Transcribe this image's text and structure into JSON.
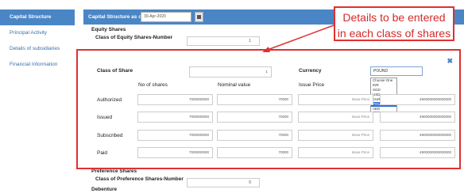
{
  "sidebar": {
    "items": [
      {
        "label": "Capital Structure"
      },
      {
        "label": "Principal Activity"
      },
      {
        "label": "Details of subsidiaries"
      },
      {
        "label": "Financial Information"
      }
    ]
  },
  "header": {
    "label": "Capital Structure as on",
    "date": "30-Apr-2020"
  },
  "form": {
    "equity_section": "Equity Shares",
    "equity_count_label": "Class of Equity Shares-Number",
    "equity_count_value": "1",
    "preference_section": "Preference Shares",
    "preference_count_label": "Class of Preference Shares-Number",
    "preference_count_value": "0",
    "debenture_section": "Debenture"
  },
  "callout": {
    "line1": "Details to be entered",
    "line2": "in each class of shares"
  },
  "modal": {
    "class_of_share_label": "Class of Share",
    "class_of_share_value": "1",
    "currency_label": "Currency",
    "currency_selected": "POUND",
    "currency_options": [
      "Choose One",
      "INR",
      "SGD",
      "USD",
      "EUR",
      "POUND",
      "AED"
    ],
    "columns": [
      "No of shares",
      "Nominal value",
      "Issue Price",
      ""
    ],
    "issue_price_placeholder": "Issue Price",
    "rows": [
      {
        "label": "Authorized",
        "shares": "7000000000",
        "nominal": "70000",
        "total": "4900000000000000"
      },
      {
        "label": "Issued",
        "shares": "7000000000",
        "nominal": "70000",
        "total": "4900000000000000"
      },
      {
        "label": "Subscribed",
        "shares": "7000000000",
        "nominal": "70000",
        "total": "4900000000000000"
      },
      {
        "label": "Paid",
        "shares": "7000000000",
        "nominal": "70000",
        "total": "4900000000000000"
      }
    ]
  },
  "colors": {
    "accent": "#4a86c5",
    "annotation": "#e03030"
  }
}
